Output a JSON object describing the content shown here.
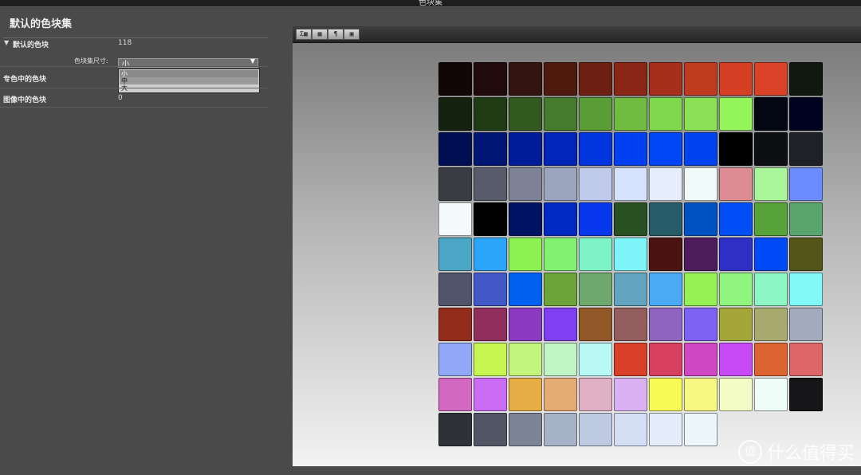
{
  "window": {
    "title": "色块集"
  },
  "panel": {
    "title": "默认的色块集",
    "rows": [
      {
        "label": "默认的色块",
        "value": "118"
      },
      {
        "label": "专色中的色块",
        "value": ""
      },
      {
        "label": "图像中的色块",
        "value": "0"
      }
    ],
    "size_label": "色块集尺寸:",
    "size_value": "小",
    "size_options": [
      "小",
      "中",
      "大"
    ]
  },
  "toolbar": {
    "buttons": [
      {
        "label": "Σ▦",
        "icon": "sum-list-icon"
      },
      {
        "label": "▦",
        "icon": "grid-icon"
      },
      {
        "label": "¶",
        "icon": "swatch-icon"
      },
      {
        "label": "▣",
        "icon": "image-icon"
      }
    ]
  },
  "swatches": [
    [
      "#120606",
      "#210a0a",
      "#331410",
      "#4f190e",
      "#6d1f12",
      "#8a2615",
      "#a52f1b",
      "#c03a20",
      "#d43e22",
      "#da4227",
      "#101810"
    ],
    [
      "#14220f",
      "#1f3b14",
      "#325a20",
      "#447b2d",
      "#5a9c36",
      "#6fbc40",
      "#7fd94c",
      "#8ae155",
      "#93f55a",
      "#030713",
      "#000320"
    ],
    [
      "#000f52",
      "#001674",
      "#001c96",
      "#0025b8",
      "#0034dc",
      "#0040f0",
      "#0046f6",
      "#0044f0",
      "#000000",
      "#0d0f12",
      "#1e2126"
    ],
    [
      "#393c43",
      "#585c6a",
      "#7d8296",
      "#9ba5be",
      "#c0caea",
      "#d6e2fc",
      "#e6eefb",
      "#f0faf9",
      "#dd8c93",
      "#a8f59a",
      "#6a8cff"
    ],
    [
      "#f3fbfd",
      "#010101",
      "#021262",
      "#0028c2",
      "#0838ee",
      "#285020",
      "#255c68",
      "#0052c2",
      "#004ef5",
      "#58a23a",
      "#58a66d"
    ],
    [
      "#4aa6c4",
      "#2aa5f9",
      "#8cf251",
      "#82f172",
      "#7ef3c8",
      "#7cf4f8",
      "#4c1410",
      "#4e1c5a",
      "#2f2fc6",
      "#0049f6",
      "#525418"
    ],
    [
      "#50546a",
      "#4158c6",
      "#0060f0",
      "#6ca43a",
      "#6fa86c",
      "#62a4be",
      "#4aaaf4",
      "#95f254",
      "#90f57e",
      "#8cf6c5",
      "#80f9f8"
    ],
    [
      "#922c1a",
      "#902e5e",
      "#8a3ac0",
      "#7e40f2",
      "#925828",
      "#925e5e",
      "#8e64c0",
      "#7e62f4",
      "#a4a63a",
      "#a6aa6e",
      "#a2aabe"
    ],
    [
      "#90a8f6",
      "#c6f650",
      "#c2f47e",
      "#c0f6c6",
      "#b8f8f5",
      "#d8402a",
      "#d84060",
      "#d048c2",
      "#c84af6",
      "#dc6430",
      "#dc6668"
    ],
    [
      "#d268c2",
      "#ca6cf4",
      "#e6ae44",
      "#e4ac72",
      "#e0b0c4",
      "#dab2f4",
      "#f8fa56",
      "#f6f882",
      "#f4fcc6",
      "#effdf8",
      "#161618"
    ],
    [
      "#2e3238",
      "#505664",
      "#7c8496",
      "#a6b2c8",
      "#bec9e2",
      "#d4dff6",
      "#e3eefa",
      "#edf6fb"
    ]
  ],
  "watermark": {
    "text": "什么值得买",
    "logo": "值"
  }
}
